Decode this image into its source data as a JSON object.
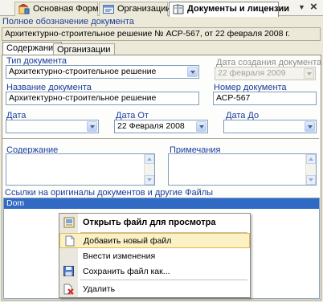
{
  "doc_tabs": [
    {
      "label": "Основная Форма"
    },
    {
      "label": "Организации"
    },
    {
      "label": "Документы и лицензии"
    }
  ],
  "window_controls": {
    "dropdown": "▼",
    "close": "×"
  },
  "full_designation": {
    "label": "Полное обозначение документа",
    "value": "Архитектурно-строительное решение № АСР-567, от 22 февраля 2008 г."
  },
  "sub_tabs": [
    {
      "label": "Содержание"
    },
    {
      "label": "Организации"
    }
  ],
  "form": {
    "doc_type": {
      "label": "Тип документа",
      "value": "Архитектурно-строительное решение"
    },
    "created_date": {
      "label": "Дата создания документа",
      "value": "22 февраля 2009"
    },
    "doc_name": {
      "label": "Название документа",
      "value": "Архитектурно-строительное решение"
    },
    "doc_number": {
      "label": "Номер документа",
      "value": "АСР-567"
    },
    "date": {
      "label": "Дата",
      "value": ""
    },
    "date_from": {
      "label": "Дата От",
      "value": "22 Февраля 2008"
    },
    "date_to": {
      "label": "Дата До",
      "value": ""
    },
    "content": {
      "label": "Содержание",
      "value": ""
    },
    "notes": {
      "label": "Примечания",
      "value": ""
    }
  },
  "files": {
    "label": "Ссылки на оригиналы документов и другие Файлы",
    "items": [
      {
        "name": "Dom",
        "selected": true
      }
    ]
  },
  "context_menu": {
    "items": [
      {
        "label": "Открыть файл для просмотра",
        "bold": true,
        "icon": "document-view-icon"
      },
      {
        "label": "Добавить новый файл",
        "highlighted": true,
        "icon": "new-file-icon"
      },
      {
        "label": "Внести изменения",
        "icon": null
      },
      {
        "label": "Сохранить файл как...",
        "icon": "save-disk-icon"
      },
      {
        "label": "Удалить",
        "icon": "delete-icon"
      }
    ]
  },
  "colors": {
    "label_blue": "#1a3d9e",
    "selection_blue": "#316ac5",
    "menu_highlight": "#fbf1c5"
  }
}
